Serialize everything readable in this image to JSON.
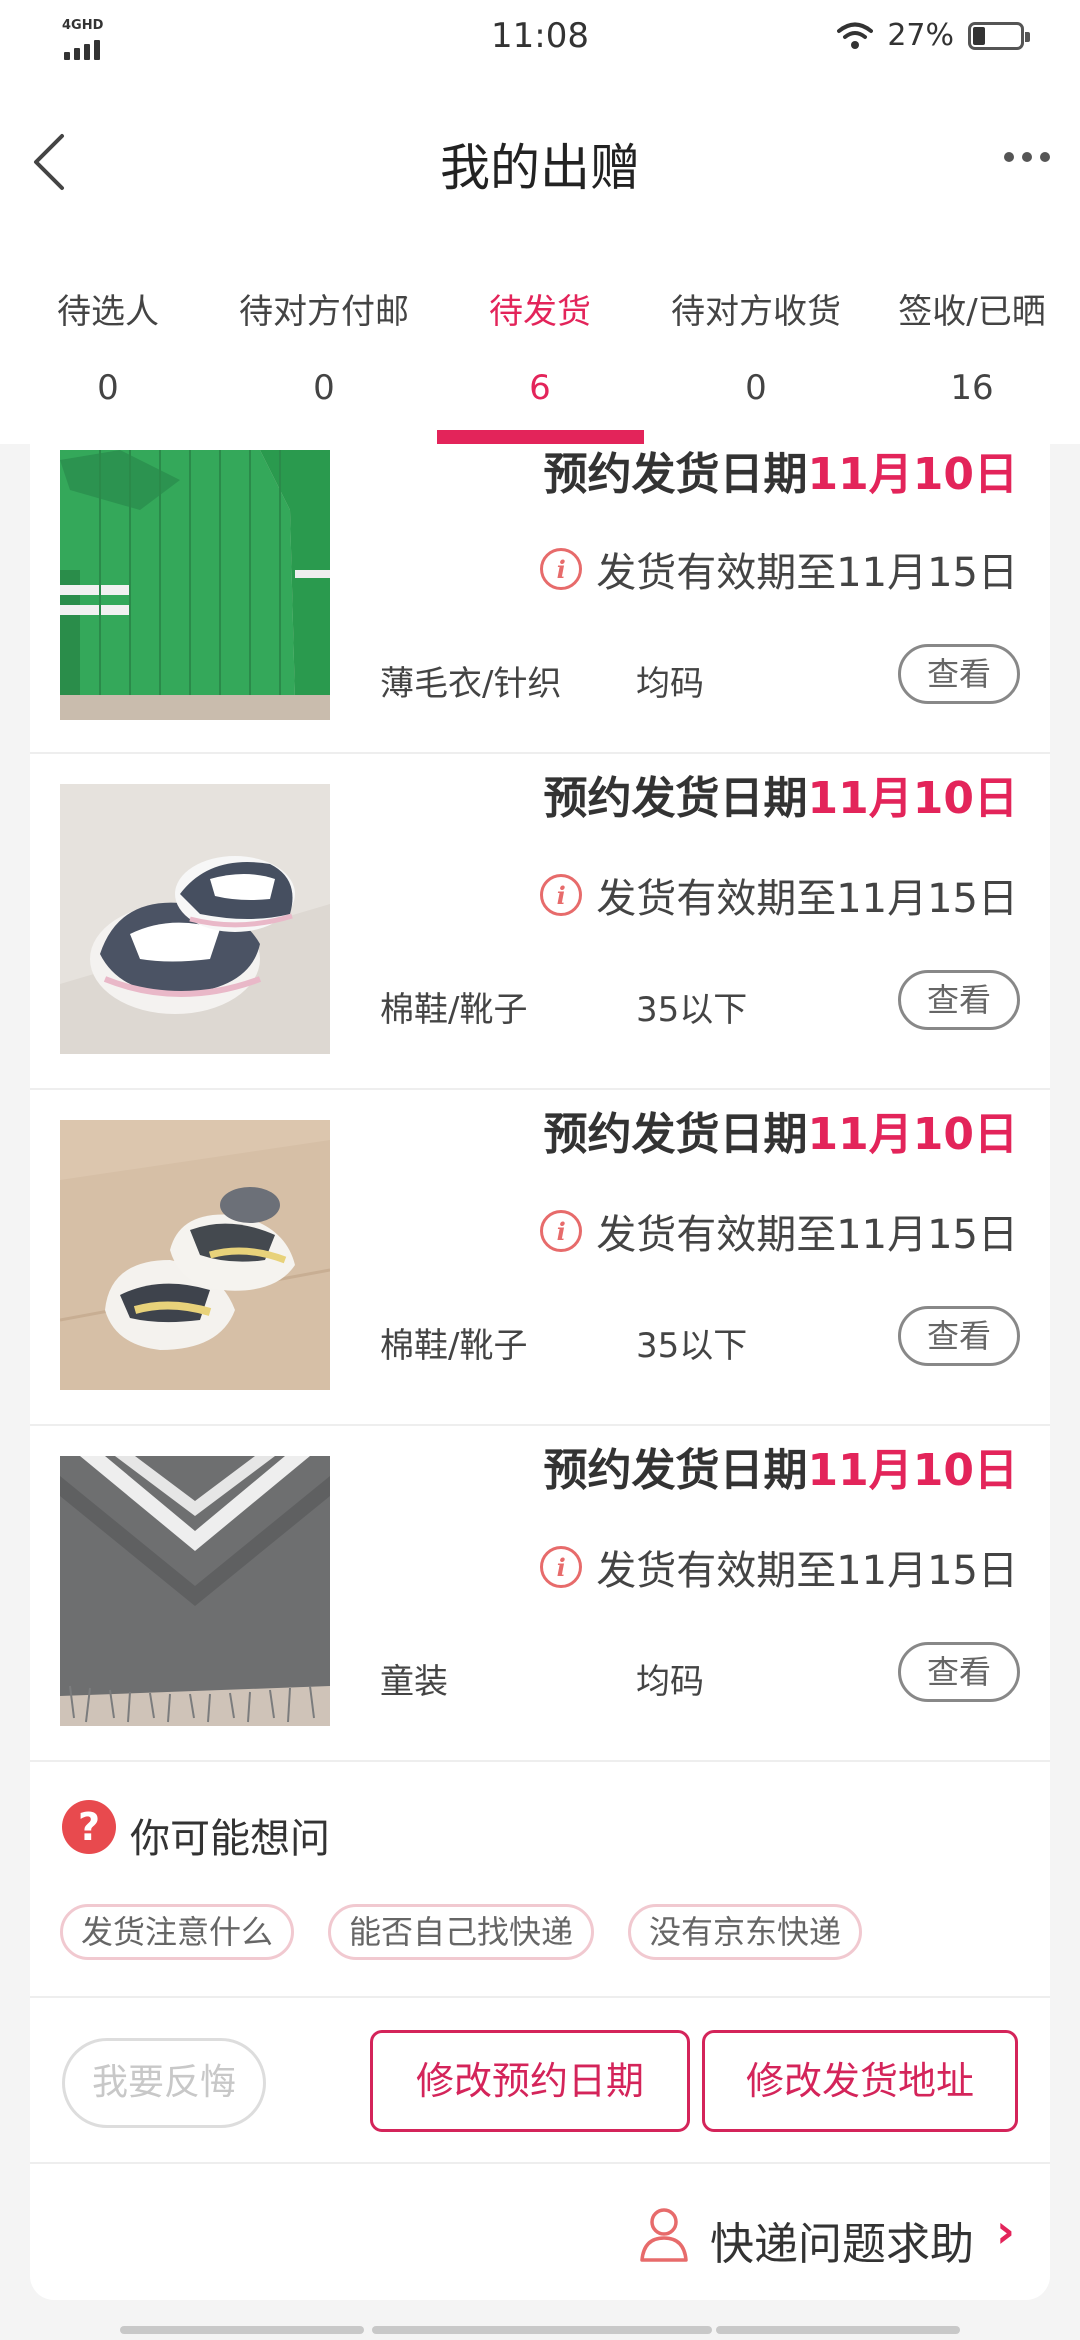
{
  "status_bar": {
    "network": "4GHD",
    "time": "11:08",
    "battery": "27%",
    "battery_level": 0.27
  },
  "header": {
    "title": "我的出赠"
  },
  "tabs": [
    {
      "label": "待选人",
      "count": "0",
      "active": false
    },
    {
      "label": "待对方付邮",
      "count": "0",
      "active": false
    },
    {
      "label": "待发货",
      "count": "6",
      "active": true
    },
    {
      "label": "待对方收货",
      "count": "0",
      "active": false
    },
    {
      "label": "签收/已晒",
      "count": "16",
      "active": false
    }
  ],
  "items": [
    {
      "schedule_label": "预约发货日期",
      "schedule_date": "11月10日",
      "deadline": "发货有效期至11月15日",
      "category": "薄毛衣/针织",
      "size": "均码",
      "view_label": "查看",
      "photo": "green-sweater"
    },
    {
      "schedule_label": "预约发货日期",
      "schedule_date": "11月10日",
      "deadline": "发货有效期至11月15日",
      "category": "棉鞋/靴子",
      "size": "35以下",
      "view_label": "查看",
      "photo": "sneakers-pink"
    },
    {
      "schedule_label": "预约发货日期",
      "schedule_date": "11月10日",
      "deadline": "发货有效期至11月15日",
      "category": "棉鞋/靴子",
      "size": "35以下",
      "view_label": "查看",
      "photo": "sneakers-yellow"
    },
    {
      "schedule_label": "预约发货日期",
      "schedule_date": "11月10日",
      "deadline": "发货有效期至11月15日",
      "category": "童装",
      "size": "均码",
      "view_label": "查看",
      "photo": "gray-poncho"
    }
  ],
  "faq": {
    "title": "你可能想问",
    "chips": [
      "发货注意什么",
      "能否自己找快递",
      "没有京东快递"
    ]
  },
  "actions": {
    "regret_label": "我要反悔",
    "change_date_label": "修改预约日期",
    "change_address_label": "修改发货地址"
  },
  "courier_help": {
    "label": "快递问题求助"
  },
  "colors": {
    "accent": "#e3245a",
    "help_icon": "#e84a4e",
    "background": "#f4f4f4"
  }
}
